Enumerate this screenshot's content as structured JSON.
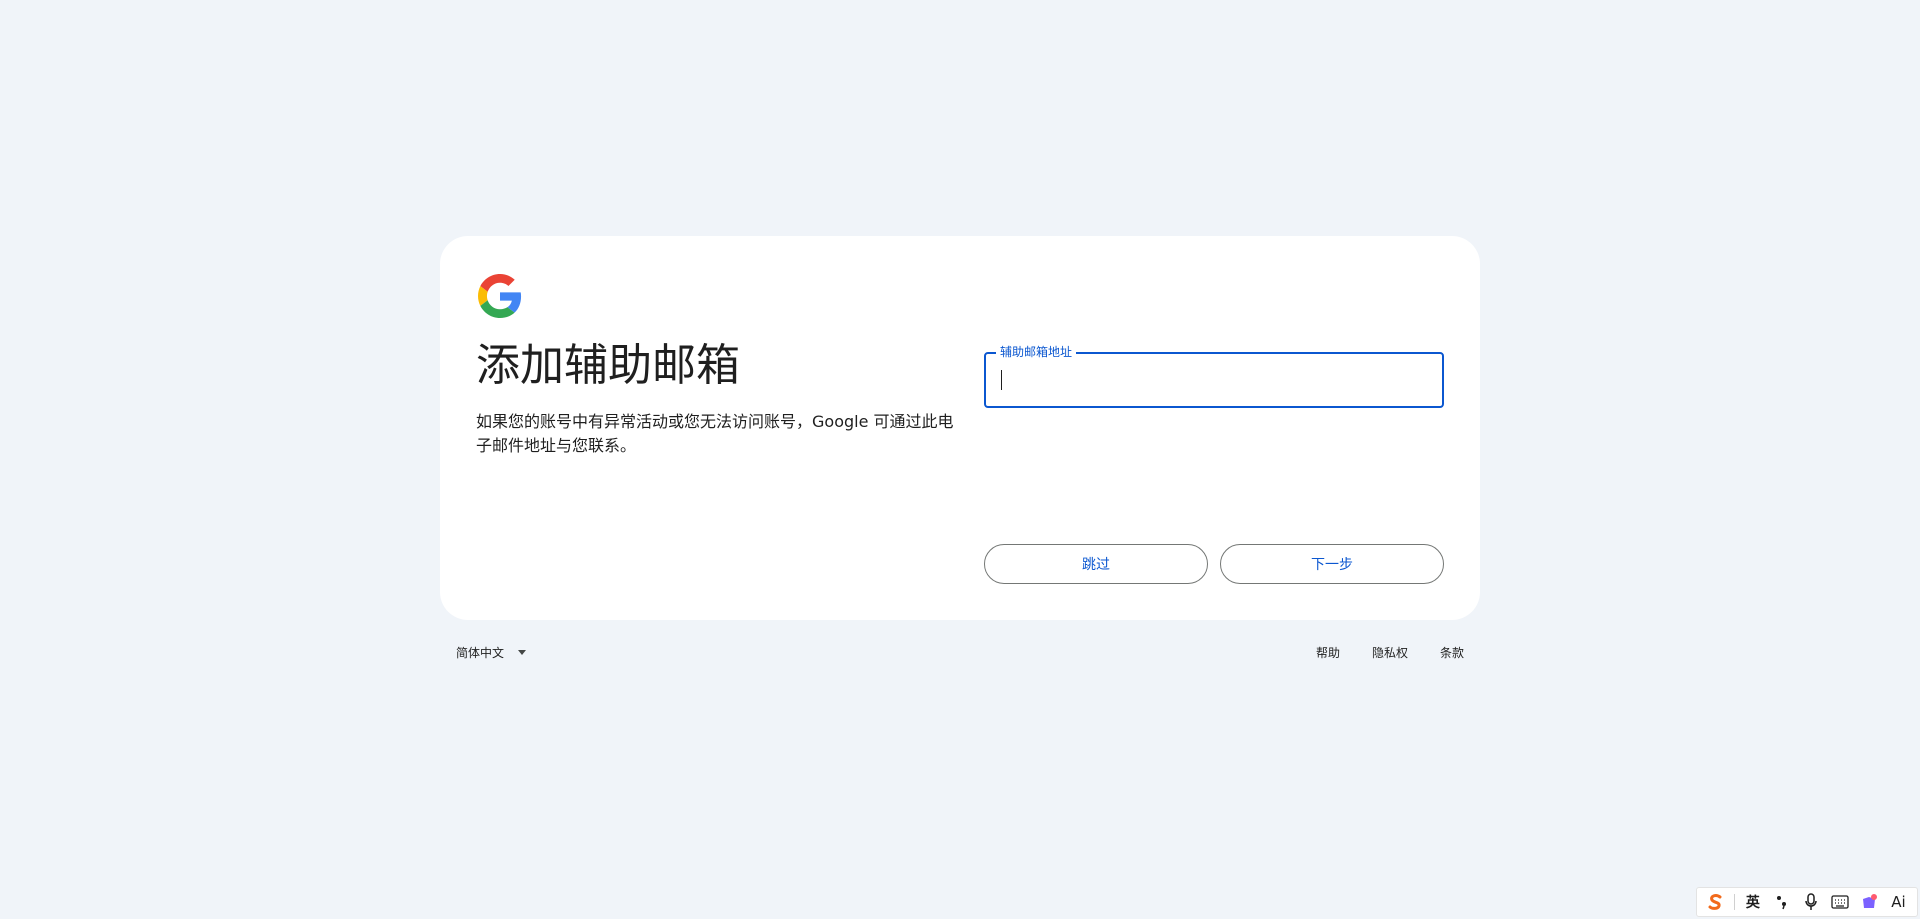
{
  "card": {
    "logo": "google-g-logo",
    "title": "添加辅助邮箱",
    "description": "如果您的账号中有异常活动或您无法访问账号，Google 可通过此电子邮件地址与您联系。",
    "field": {
      "label": "辅助邮箱地址",
      "value": ""
    },
    "buttons": {
      "skip": "跳过",
      "next": "下一步"
    }
  },
  "footer": {
    "language": "简体中文",
    "links": [
      "帮助",
      "隐私权",
      "条款"
    ]
  },
  "ime_toolbar": {
    "mode": "英",
    "ai_label": "Ai"
  },
  "colors": {
    "background": "#f0f4f9",
    "accent": "#0b57d0",
    "google_blue": "#4285F4",
    "google_red": "#EA4335",
    "google_yellow": "#FBBC05",
    "google_green": "#34A853"
  }
}
